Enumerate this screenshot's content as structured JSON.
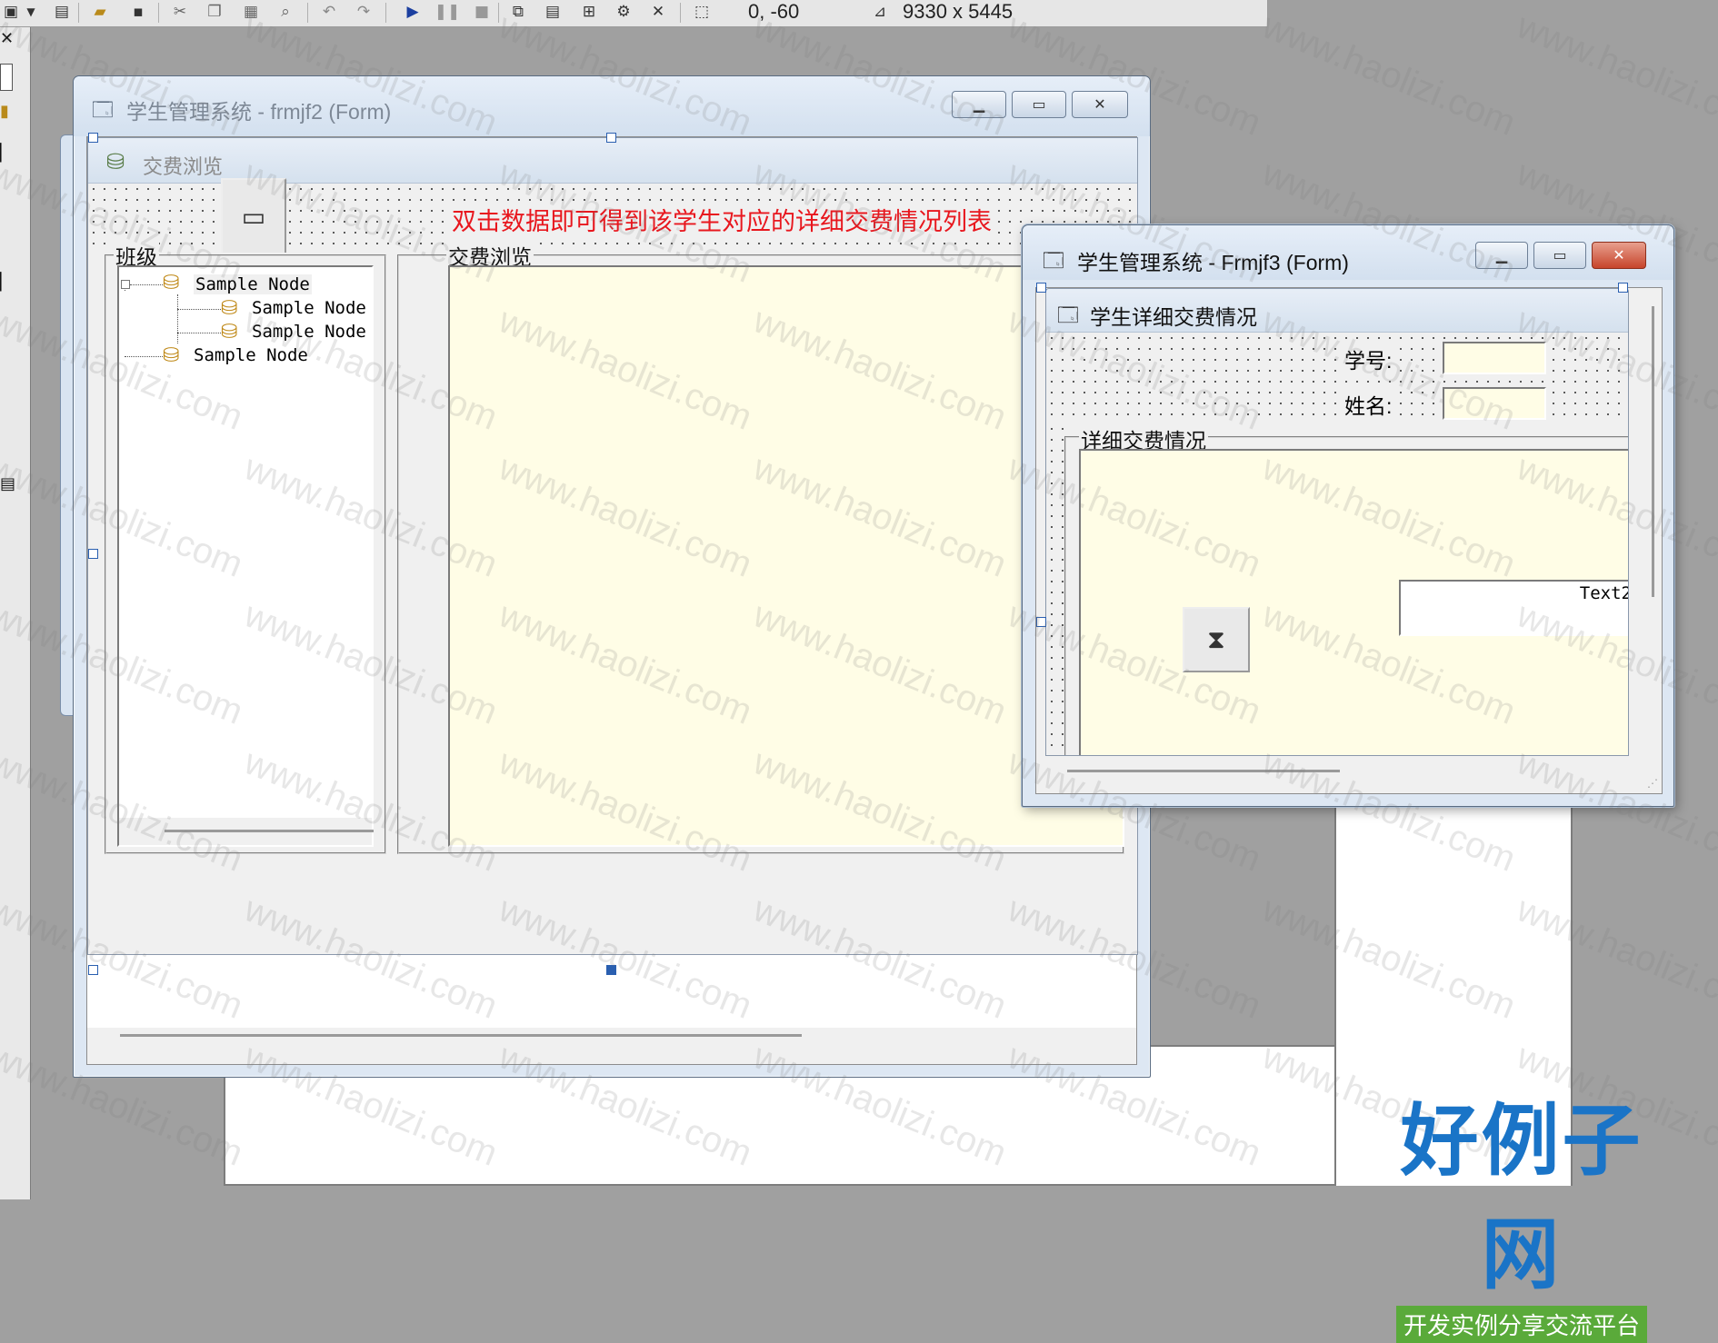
{
  "toolbar": {
    "position_readout": "0, -60",
    "size_readout": "9330 x 5445"
  },
  "form1": {
    "title": "学生管理系统 - frmjf2 (Form)",
    "child_title": "交费浏览",
    "hint_text": "双击数据即可得到该学生对应的详细交费情况列表",
    "group_class_label": "班级",
    "group_fee_label": "交费浏览",
    "tree_nodes": [
      "Sample Node",
      "Sample Node",
      "Sample Node",
      "Sample Node"
    ]
  },
  "form2": {
    "title": "学生管理系统 - Frmjf3 (Form)",
    "child_title": "学生详细交费情况",
    "student_id_label": "学号:",
    "name_label": "姓名:",
    "student_id_value": "",
    "name_value": "",
    "group_detail_label": "详细交费情况",
    "text2_value": "Text2"
  },
  "watermark": {
    "text": "www.haolizi.com",
    "logo_main": "好例子网",
    "logo_sub": "开发实例分享交流平台"
  },
  "colors": {
    "hint_red": "#e8171e",
    "canvas_yellow": "#fffde6",
    "logo_blue": "#1a74c7",
    "logo_green": "#5aaa3a"
  },
  "icons": [
    "new-form-icon",
    "open-icon",
    "save-icon",
    "cut-icon",
    "copy-icon",
    "paste-icon",
    "find-icon",
    "undo-icon",
    "redo-icon",
    "run-icon",
    "pause-icon",
    "stop-icon",
    "project-explorer-icon",
    "properties-icon",
    "form-layout-icon",
    "object-browser-icon",
    "toolbox-icon",
    "position-icon",
    "size-icon"
  ]
}
